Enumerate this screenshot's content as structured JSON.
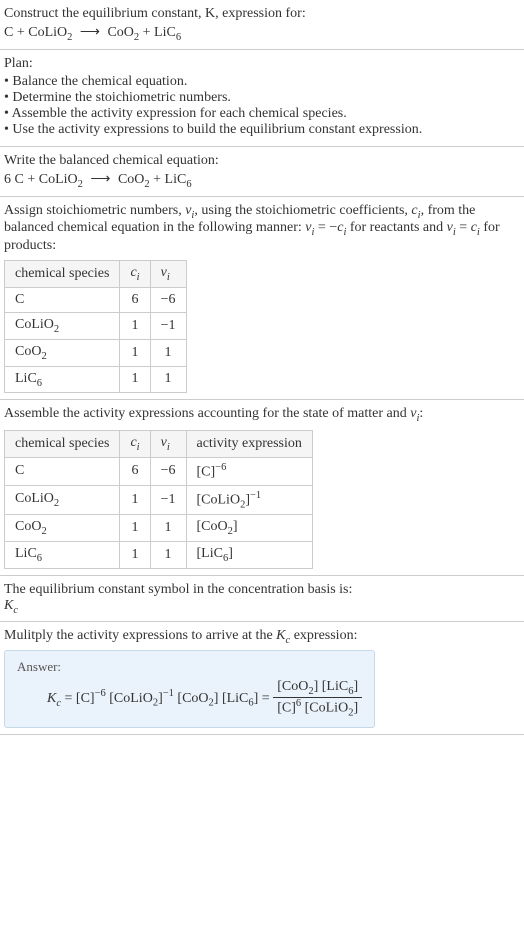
{
  "problem": {
    "title": "Construct the equilibrium constant, K, expression for:",
    "equation_html": "C + CoLiO<span class='sub'>2</span> <span class='arrow'>⟶</span> CoO<span class='sub'>2</span> + LiC<span class='sub'>6</span>"
  },
  "plan": {
    "heading": "Plan:",
    "items": [
      "• Balance the chemical equation.",
      "• Determine the stoichiometric numbers.",
      "• Assemble the activity expression for each chemical species.",
      "• Use the activity expressions to build the equilibrium constant expression."
    ]
  },
  "balanced": {
    "heading": "Write the balanced chemical equation:",
    "equation_html": "6 C + CoLiO<span class='sub'>2</span> <span class='arrow'>⟶</span> CoO<span class='sub'>2</span> + LiC<span class='sub'>6</span>"
  },
  "stoich": {
    "heading_html": "Assign stoichiometric numbers, <span class='italic'>ν<span class='sub'>i</span></span>, using the stoichiometric coefficients, <span class='italic'>c<span class='sub'>i</span></span>, from the balanced chemical equation in the following manner: <span class='italic'>ν<span class='sub'>i</span></span> = −<span class='italic'>c<span class='sub'>i</span></span> for reactants and <span class='italic'>ν<span class='sub'>i</span></span> = <span class='italic'>c<span class='sub'>i</span></span> for products:",
    "headers_html": [
      "chemical species",
      "<span class='italic'>c<span class='sub'>i</span></span>",
      "<span class='italic'>ν<span class='sub'>i</span></span>"
    ],
    "rows_html": [
      [
        "C",
        "6",
        "−6"
      ],
      [
        "CoLiO<span class='sub'>2</span>",
        "1",
        "−1"
      ],
      [
        "CoO<span class='sub'>2</span>",
        "1",
        "1"
      ],
      [
        "LiC<span class='sub'>6</span>",
        "1",
        "1"
      ]
    ]
  },
  "activity": {
    "heading_html": "Assemble the activity expressions accounting for the state of matter and <span class='italic'>ν<span class='sub'>i</span></span>:",
    "headers_html": [
      "chemical species",
      "<span class='italic'>c<span class='sub'>i</span></span>",
      "<span class='italic'>ν<span class='sub'>i</span></span>",
      "activity expression"
    ],
    "rows_html": [
      [
        "C",
        "6",
        "−6",
        "[C]<span class='sup'>−6</span>"
      ],
      [
        "CoLiO<span class='sub'>2</span>",
        "1",
        "−1",
        "[CoLiO<span class='sub'>2</span>]<span class='sup'>−1</span>"
      ],
      [
        "CoO<span class='sub'>2</span>",
        "1",
        "1",
        "[CoO<span class='sub'>2</span>]"
      ],
      [
        "LiC<span class='sub'>6</span>",
        "1",
        "1",
        "[LiC<span class='sub'>6</span>]"
      ]
    ]
  },
  "symbol": {
    "heading": "The equilibrium constant symbol in the concentration basis is:",
    "value_html": "<span class='italic'>K<span class='sub'>c</span></span>"
  },
  "multiply": {
    "heading_html": "Mulitply the activity expressions to arrive at the <span class='italic'>K<span class='sub'>c</span></span> expression:"
  },
  "answer": {
    "label": "Answer:",
    "expr_html": "<span class='italic'>K<span class='sub'>c</span></span> = [C]<span class='sup'>−6</span> [CoLiO<span class='sub'>2</span>]<span class='sup'>−1</span> [CoO<span class='sub'>2</span>] [LiC<span class='sub'>6</span>] = <span class='frac'><span class='num'>[CoO<span class='sub'>2</span>] [LiC<span class='sub'>6</span>]</span><span class='den'>[C]<span class='sup'>6</span> [CoLiO<span class='sub'>2</span>]</span></span>"
  }
}
